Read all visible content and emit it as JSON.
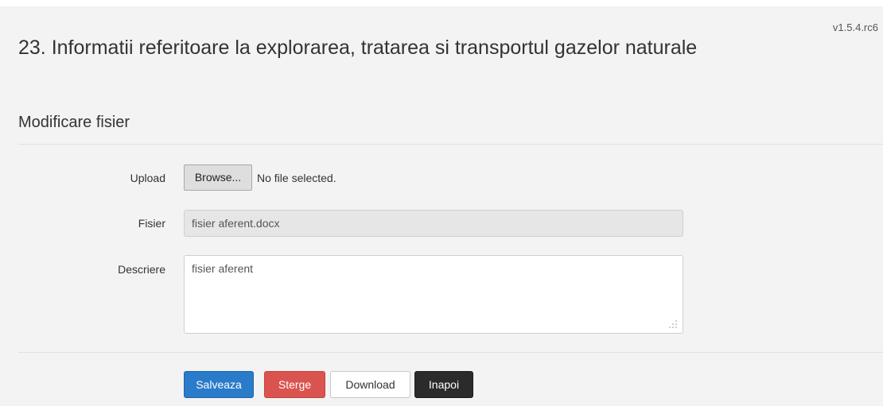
{
  "version": "v1.5.4.rc6",
  "page": {
    "title": "23. Informatii referitoare la explorarea, tratarea si transportul gazelor naturale",
    "section_title": "Modificare fisier"
  },
  "form": {
    "upload": {
      "label": "Upload",
      "browse_label": "Browse...",
      "status": "No file selected."
    },
    "fisier": {
      "label": "Fisier",
      "value": "fisier aferent.docx"
    },
    "descriere": {
      "label": "Descriere",
      "value": "fisier aferent"
    }
  },
  "actions": {
    "save_label": "Salveaza",
    "delete_label": "Sterge",
    "download_label": "Download",
    "back_label": "Inapoi"
  },
  "colors": {
    "background": "#f3f3f3",
    "save": "#2a7bc9",
    "delete": "#d9534f",
    "download": "#ffffff",
    "back": "#2b2b2b"
  }
}
